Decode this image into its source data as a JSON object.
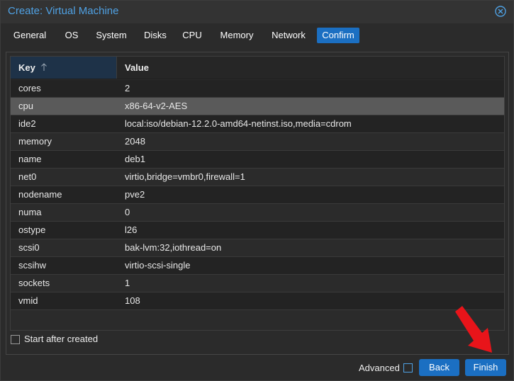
{
  "window": {
    "title": "Create: Virtual Machine"
  },
  "tabs": [
    {
      "label": "General"
    },
    {
      "label": "OS"
    },
    {
      "label": "System"
    },
    {
      "label": "Disks"
    },
    {
      "label": "CPU"
    },
    {
      "label": "Memory"
    },
    {
      "label": "Network"
    },
    {
      "label": "Confirm",
      "active": true
    }
  ],
  "grid": {
    "columns": {
      "key": "Key",
      "value": "Value"
    },
    "sort": "ascending",
    "selected_row": "cpu",
    "rows": [
      {
        "key": "cores",
        "value": "2"
      },
      {
        "key": "cpu",
        "value": "x86-64-v2-AES"
      },
      {
        "key": "ide2",
        "value": "local:iso/debian-12.2.0-amd64-netinst.iso,media=cdrom"
      },
      {
        "key": "memory",
        "value": "2048"
      },
      {
        "key": "name",
        "value": "deb1"
      },
      {
        "key": "net0",
        "value": "virtio,bridge=vmbr0,firewall=1"
      },
      {
        "key": "nodename",
        "value": "pve2"
      },
      {
        "key": "numa",
        "value": "0"
      },
      {
        "key": "ostype",
        "value": "l26"
      },
      {
        "key": "scsi0",
        "value": "bak-lvm:32,iothread=on"
      },
      {
        "key": "scsihw",
        "value": "virtio-scsi-single"
      },
      {
        "key": "sockets",
        "value": "1"
      },
      {
        "key": "vmid",
        "value": "108"
      }
    ]
  },
  "start_after_created": {
    "label": "Start after created",
    "checked": false
  },
  "footer": {
    "advanced_label": "Advanced",
    "advanced_checked": false,
    "back_label": "Back",
    "finish_label": "Finish"
  },
  "colors": {
    "accent": "#1b6fc2",
    "title": "#4fa1e3",
    "annotation_arrow": "#e8141a"
  },
  "icons": {
    "close": "close-circle-icon",
    "sort": "sort-up-arrow-icon",
    "annotation": "red-arrow-icon"
  }
}
